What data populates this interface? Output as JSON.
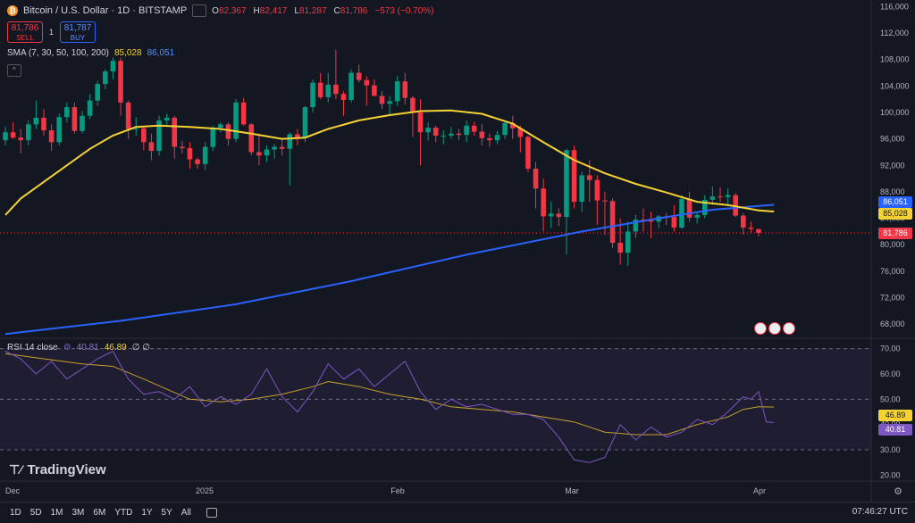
{
  "header": {
    "title": "Bitcoin / U.S. Dollar · 1D · BITSTAMP",
    "ohlc": [
      {
        "label": "O",
        "value": "82,367"
      },
      {
        "label": "H",
        "value": "82,417"
      },
      {
        "label": "L",
        "value": "81,287"
      },
      {
        "label": "C",
        "value": "81,786"
      }
    ],
    "change": "−573 (−0.70%)"
  },
  "trade": {
    "sell_price": "81,786",
    "sell_label": "SELL",
    "buy_price": "81,787",
    "buy_label": "BUY",
    "qty": "1"
  },
  "sma_indicator": {
    "label": "SMA (7, 30, 50, 100, 200)",
    "value_a": "85,028",
    "value_b": "86,051"
  },
  "rsi_indicator": {
    "label": "RSI 14 close",
    "value_a": "40.81",
    "value_b": "46.89",
    "extra": "∅ ∅"
  },
  "logo": "TradingView",
  "price_axis": {
    "ticks": [
      116000,
      112000,
      108000,
      104000,
      100000,
      96000,
      92000,
      88000,
      84000,
      80000,
      76000,
      72000,
      68000
    ],
    "labels": [
      "116,000",
      "112,000",
      "108,000",
      "104,000",
      "100,000",
      "96,000",
      "92,000",
      "88,000",
      "84,000",
      "80,000",
      "76,000",
      "72,000",
      "68,000"
    ],
    "tag_sma_b": "86,051",
    "tag_sma_a": "85,028",
    "tag_close": "81,786"
  },
  "rsi_axis": {
    "labels": [
      "70.00",
      "60.00",
      "50.00",
      "40.00",
      "30.00",
      "20.00"
    ],
    "tag_ma": "46.89",
    "tag_rsi": "40.81"
  },
  "time_axis": [
    "Dec",
    "2025",
    "Feb",
    "Mar",
    "Apr"
  ],
  "timeframes": [
    "1D",
    "5D",
    "1M",
    "3M",
    "6M",
    "YTD",
    "1Y",
    "5Y",
    "All"
  ],
  "clock": "07:46:27 UTC",
  "colors": {
    "up": "#089981",
    "down": "#f23645",
    "sma_a": "#f5d133",
    "sma_b": "#2962ff",
    "rsi": "#7e57c2",
    "rsi_ma": "#c9a227",
    "bg": "#131722"
  },
  "chart_data": {
    "type": "candlestick",
    "ylim": [
      66000,
      117000
    ],
    "candles": [
      [
        95800,
        97900,
        95000,
        97000
      ],
      [
        97000,
        98500,
        96000,
        96200
      ],
      [
        96200,
        97500,
        93800,
        95800
      ],
      [
        95800,
        98800,
        95000,
        98200
      ],
      [
        98200,
        101800,
        97500,
        99200
      ],
      [
        99200,
        100500,
        96500,
        97300
      ],
      [
        97300,
        98200,
        94200,
        95500
      ],
      [
        95500,
        99800,
        95000,
        99300
      ],
      [
        99300,
        101500,
        98500,
        100800
      ],
      [
        100800,
        101500,
        96800,
        97200
      ],
      [
        97200,
        100200,
        96800,
        99500
      ],
      [
        99500,
        102800,
        99000,
        101800
      ],
      [
        101800,
        104800,
        101000,
        104300
      ],
      [
        104300,
        106500,
        103500,
        106200
      ],
      [
        106200,
        108300,
        105000,
        107800
      ],
      [
        107800,
        108300,
        99500,
        101500
      ],
      [
        101500,
        101800,
        96000,
        97500
      ],
      [
        97500,
        99300,
        96500,
        97600
      ],
      [
        97600,
        98000,
        94300,
        95500
      ],
      [
        95500,
        96800,
        92800,
        94200
      ],
      [
        94200,
        99500,
        93500,
        98800
      ],
      [
        98800,
        99800,
        98000,
        99200
      ],
      [
        99200,
        99500,
        93000,
        94800
      ],
      [
        94800,
        95700,
        93800,
        94600
      ],
      [
        94600,
        95500,
        91500,
        92900
      ],
      [
        92900,
        93200,
        91500,
        92200
      ],
      [
        92200,
        95500,
        91300,
        94800
      ],
      [
        94800,
        98000,
        94200,
        97700
      ],
      [
        97700,
        98500,
        97000,
        98200
      ],
      [
        98200,
        98500,
        95000,
        96000
      ],
      [
        96000,
        102000,
        95500,
        101500
      ],
      [
        101500,
        102200,
        98000,
        98200
      ],
      [
        98200,
        98400,
        93500,
        94000
      ],
      [
        94000,
        96800,
        92000,
        93500
      ],
      [
        93500,
        95000,
        92500,
        94400
      ],
      [
        94400,
        95200,
        93000,
        94800
      ],
      [
        94800,
        96000,
        93500,
        94500
      ],
      [
        94500,
        97000,
        89000,
        96700
      ],
      [
        96700,
        97500,
        95000,
        96200
      ],
      [
        96200,
        101000,
        95500,
        100800
      ],
      [
        100800,
        105000,
        100000,
        104500
      ],
      [
        104500,
        106000,
        102000,
        102300
      ],
      [
        102300,
        106000,
        101500,
        104200
      ],
      [
        104200,
        109500,
        102000,
        102800
      ],
      [
        102800,
        103200,
        99500,
        101900
      ],
      [
        101900,
        106500,
        101500,
        106000
      ],
      [
        106000,
        107200,
        104500,
        104900
      ],
      [
        104900,
        105500,
        101000,
        104100
      ],
      [
        104100,
        105000,
        102500,
        102500
      ],
      [
        102500,
        103200,
        100500,
        101300
      ],
      [
        101300,
        102500,
        99500,
        101700
      ],
      [
        101700,
        105500,
        101000,
        104700
      ],
      [
        104700,
        106000,
        101200,
        102200
      ],
      [
        102200,
        102500,
        96300,
        100000
      ],
      [
        100000,
        102000,
        92000,
        97000
      ],
      [
        97000,
        98500,
        95800,
        97700
      ],
      [
        97700,
        98000,
        95500,
        96500
      ],
      [
        96500,
        97300,
        95200,
        96500
      ],
      [
        96500,
        97800,
        96000,
        96800
      ],
      [
        96800,
        97500,
        95800,
        96600
      ],
      [
        96600,
        98800,
        95500,
        98000
      ],
      [
        98000,
        98600,
        96500,
        97100
      ],
      [
        97100,
        98300,
        95000,
        96100
      ],
      [
        96100,
        96800,
        94800,
        95800
      ],
      [
        95800,
        97200,
        95200,
        96600
      ],
      [
        96600,
        98500,
        96000,
        98400
      ],
      [
        98400,
        99500,
        96000,
        97600
      ],
      [
        97600,
        98000,
        94000,
        96300
      ],
      [
        96300,
        96500,
        91000,
        91500
      ],
      [
        91500,
        92500,
        85500,
        88500
      ],
      [
        88500,
        90000,
        82000,
        84300
      ],
      [
        84300,
        86500,
        82500,
        84700
      ],
      [
        84700,
        85500,
        82800,
        84200
      ],
      [
        84200,
        94500,
        78500,
        94300
      ],
      [
        94300,
        95000,
        85500,
        86500
      ],
      [
        86500,
        91000,
        85000,
        90500
      ],
      [
        90500,
        92800,
        86500,
        89800
      ],
      [
        89800,
        90500,
        83000,
        86700
      ],
      [
        86700,
        88000,
        81500,
        86600
      ],
      [
        86600,
        87000,
        79500,
        80300
      ],
      [
        80300,
        84000,
        77000,
        78800
      ],
      [
        78800,
        83500,
        76800,
        82000
      ],
      [
        82000,
        84500,
        81000,
        83800
      ],
      [
        83800,
        85500,
        82000,
        83700
      ],
      [
        83700,
        85000,
        81000,
        83500
      ],
      [
        83500,
        84500,
        82500,
        84300
      ],
      [
        84300,
        84800,
        83000,
        84200
      ],
      [
        84200,
        86000,
        82000,
        82600
      ],
      [
        82600,
        87500,
        82400,
        86900
      ],
      [
        86900,
        88000,
        83500,
        84100
      ],
      [
        84100,
        84800,
        83200,
        84500
      ],
      [
        84500,
        87500,
        84000,
        86800
      ],
      [
        86800,
        88800,
        86000,
        87300
      ],
      [
        87300,
        88700,
        86500,
        87200
      ],
      [
        87200,
        88500,
        86000,
        87500
      ],
      [
        87500,
        87800,
        84200,
        84400
      ],
      [
        84400,
        84800,
        81500,
        82600
      ],
      [
        82600,
        83500,
        81800,
        82400
      ],
      [
        82367,
        82417,
        81287,
        81786
      ]
    ],
    "sma_a": [
      [
        0,
        84500
      ],
      [
        2,
        87000
      ],
      [
        5,
        89500
      ],
      [
        8,
        92000
      ],
      [
        11,
        94500
      ],
      [
        14,
        96500
      ],
      [
        17,
        97800
      ],
      [
        20,
        98000
      ],
      [
        24,
        97800
      ],
      [
        28,
        97500
      ],
      [
        32,
        96800
      ],
      [
        36,
        96000
      ],
      [
        39,
        96200
      ],
      [
        42,
        97500
      ],
      [
        46,
        98800
      ],
      [
        50,
        99600
      ],
      [
        54,
        100200
      ],
      [
        58,
        100300
      ],
      [
        62,
        99800
      ],
      [
        66,
        98300
      ],
      [
        70,
        95500
      ],
      [
        74,
        92800
      ],
      [
        78,
        90800
      ],
      [
        82,
        89200
      ],
      [
        86,
        87900
      ],
      [
        90,
        86500
      ],
      [
        94,
        86000
      ],
      [
        98,
        85200
      ],
      [
        100,
        85028
      ]
    ],
    "sma_b": [
      [
        0,
        66500
      ],
      [
        15,
        68500
      ],
      [
        30,
        71000
      ],
      [
        45,
        74500
      ],
      [
        60,
        78500
      ],
      [
        75,
        82000
      ],
      [
        85,
        84000
      ],
      [
        92,
        85300
      ],
      [
        100,
        86051
      ]
    ],
    "rsi": [
      [
        0,
        69
      ],
      [
        2,
        66
      ],
      [
        4,
        60
      ],
      [
        6,
        65
      ],
      [
        8,
        58
      ],
      [
        10,
        62
      ],
      [
        12,
        66
      ],
      [
        14,
        69
      ],
      [
        16,
        58
      ],
      [
        18,
        52
      ],
      [
        20,
        53
      ],
      [
        22,
        50
      ],
      [
        24,
        55
      ],
      [
        26,
        47
      ],
      [
        28,
        51
      ],
      [
        30,
        48
      ],
      [
        32,
        52
      ],
      [
        34,
        62
      ],
      [
        36,
        51
      ],
      [
        38,
        45
      ],
      [
        40,
        53
      ],
      [
        42,
        64
      ],
      [
        44,
        58
      ],
      [
        46,
        62
      ],
      [
        48,
        55
      ],
      [
        50,
        60
      ],
      [
        52,
        65
      ],
      [
        54,
        53
      ],
      [
        56,
        46
      ],
      [
        58,
        50
      ],
      [
        60,
        47
      ],
      [
        62,
        48
      ],
      [
        64,
        46
      ],
      [
        66,
        44
      ],
      [
        68,
        44
      ],
      [
        70,
        42
      ],
      [
        72,
        35
      ],
      [
        74,
        26
      ],
      [
        76,
        25
      ],
      [
        78,
        27
      ],
      [
        80,
        40
      ],
      [
        82,
        34
      ],
      [
        84,
        39
      ],
      [
        86,
        35
      ],
      [
        88,
        37
      ],
      [
        90,
        42
      ],
      [
        92,
        40
      ],
      [
        94,
        45
      ],
      [
        96,
        51
      ],
      [
        97,
        50
      ],
      [
        98,
        53
      ],
      [
        99,
        41
      ],
      [
        100,
        40.81
      ]
    ],
    "rsi_ma": [
      [
        0,
        68
      ],
      [
        5,
        66
      ],
      [
        10,
        64
      ],
      [
        14,
        63
      ],
      [
        18,
        58
      ],
      [
        24,
        50
      ],
      [
        28,
        49
      ],
      [
        32,
        50
      ],
      [
        36,
        52
      ],
      [
        40,
        55
      ],
      [
        42,
        57
      ],
      [
        46,
        55
      ],
      [
        50,
        52
      ],
      [
        54,
        50
      ],
      [
        58,
        47
      ],
      [
        62,
        46
      ],
      [
        66,
        45
      ],
      [
        70,
        43
      ],
      [
        74,
        41
      ],
      [
        78,
        37
      ],
      [
        82,
        36
      ],
      [
        86,
        36
      ],
      [
        90,
        40
      ],
      [
        94,
        43
      ],
      [
        96,
        46
      ],
      [
        98,
        47
      ],
      [
        100,
        46.89
      ]
    ]
  }
}
